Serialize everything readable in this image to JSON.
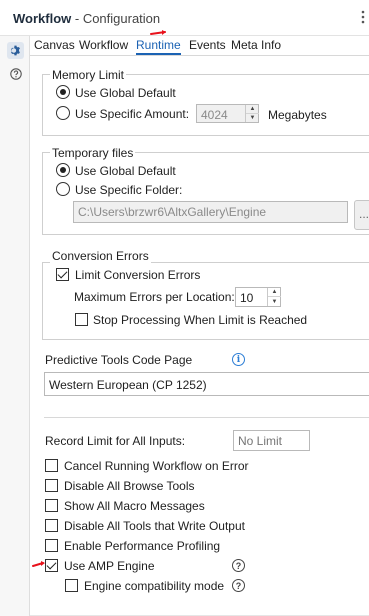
{
  "window": {
    "title_bold": "Workflow",
    "title_rest": " - Configuration",
    "menu_icon": "vertical-dots-icon"
  },
  "rail": {
    "items": [
      {
        "icon": "gear-icon",
        "active": true
      },
      {
        "icon": "help-circle-icon",
        "active": false
      }
    ]
  },
  "tabs": [
    {
      "label": "Canvas"
    },
    {
      "label": "Workflow"
    },
    {
      "label": "Runtime",
      "active": true
    },
    {
      "label": "Events"
    },
    {
      "label": "Meta Info"
    }
  ],
  "memory": {
    "title": "Memory Limit",
    "global_label": "Use Global Default",
    "specific_label": "Use Specific Amount:",
    "amount": "4024",
    "unit": "Megabytes",
    "selected": "global"
  },
  "temp": {
    "title": "Temporary files",
    "global_label": "Use Global Default",
    "specific_label": "Use Specific Folder:",
    "folder": "C:\\Users\\brzwr6\\AltxGallery\\Engine",
    "browse_label": "...",
    "selected": "global"
  },
  "conversion": {
    "title": "Conversion Errors",
    "limit_label": "Limit Conversion Errors",
    "limit_checked": true,
    "max_label": "Maximum Errors per Location:",
    "max_value": "10",
    "stop_label": "Stop Processing When Limit is Reached",
    "stop_checked": false
  },
  "codepage": {
    "label": "Predictive Tools Code Page",
    "value": "Western European (CP 1252)"
  },
  "record_limit": {
    "label": "Record Limit for All Inputs:",
    "placeholder": "No Limit"
  },
  "options": [
    {
      "label": "Cancel Running Workflow on Error",
      "checked": false
    },
    {
      "label": "Disable All Browse Tools",
      "checked": false
    },
    {
      "label": "Show All Macro Messages",
      "checked": false
    },
    {
      "label": "Disable All Tools that Write Output",
      "checked": false
    },
    {
      "label": "Enable Performance Profiling",
      "checked": false
    },
    {
      "label": "Use AMP Engine",
      "checked": true
    },
    {
      "label": "Engine compatibility mode",
      "checked": false
    }
  ],
  "colors": {
    "accent": "#1b62b3",
    "annotation": "#e8121c"
  }
}
